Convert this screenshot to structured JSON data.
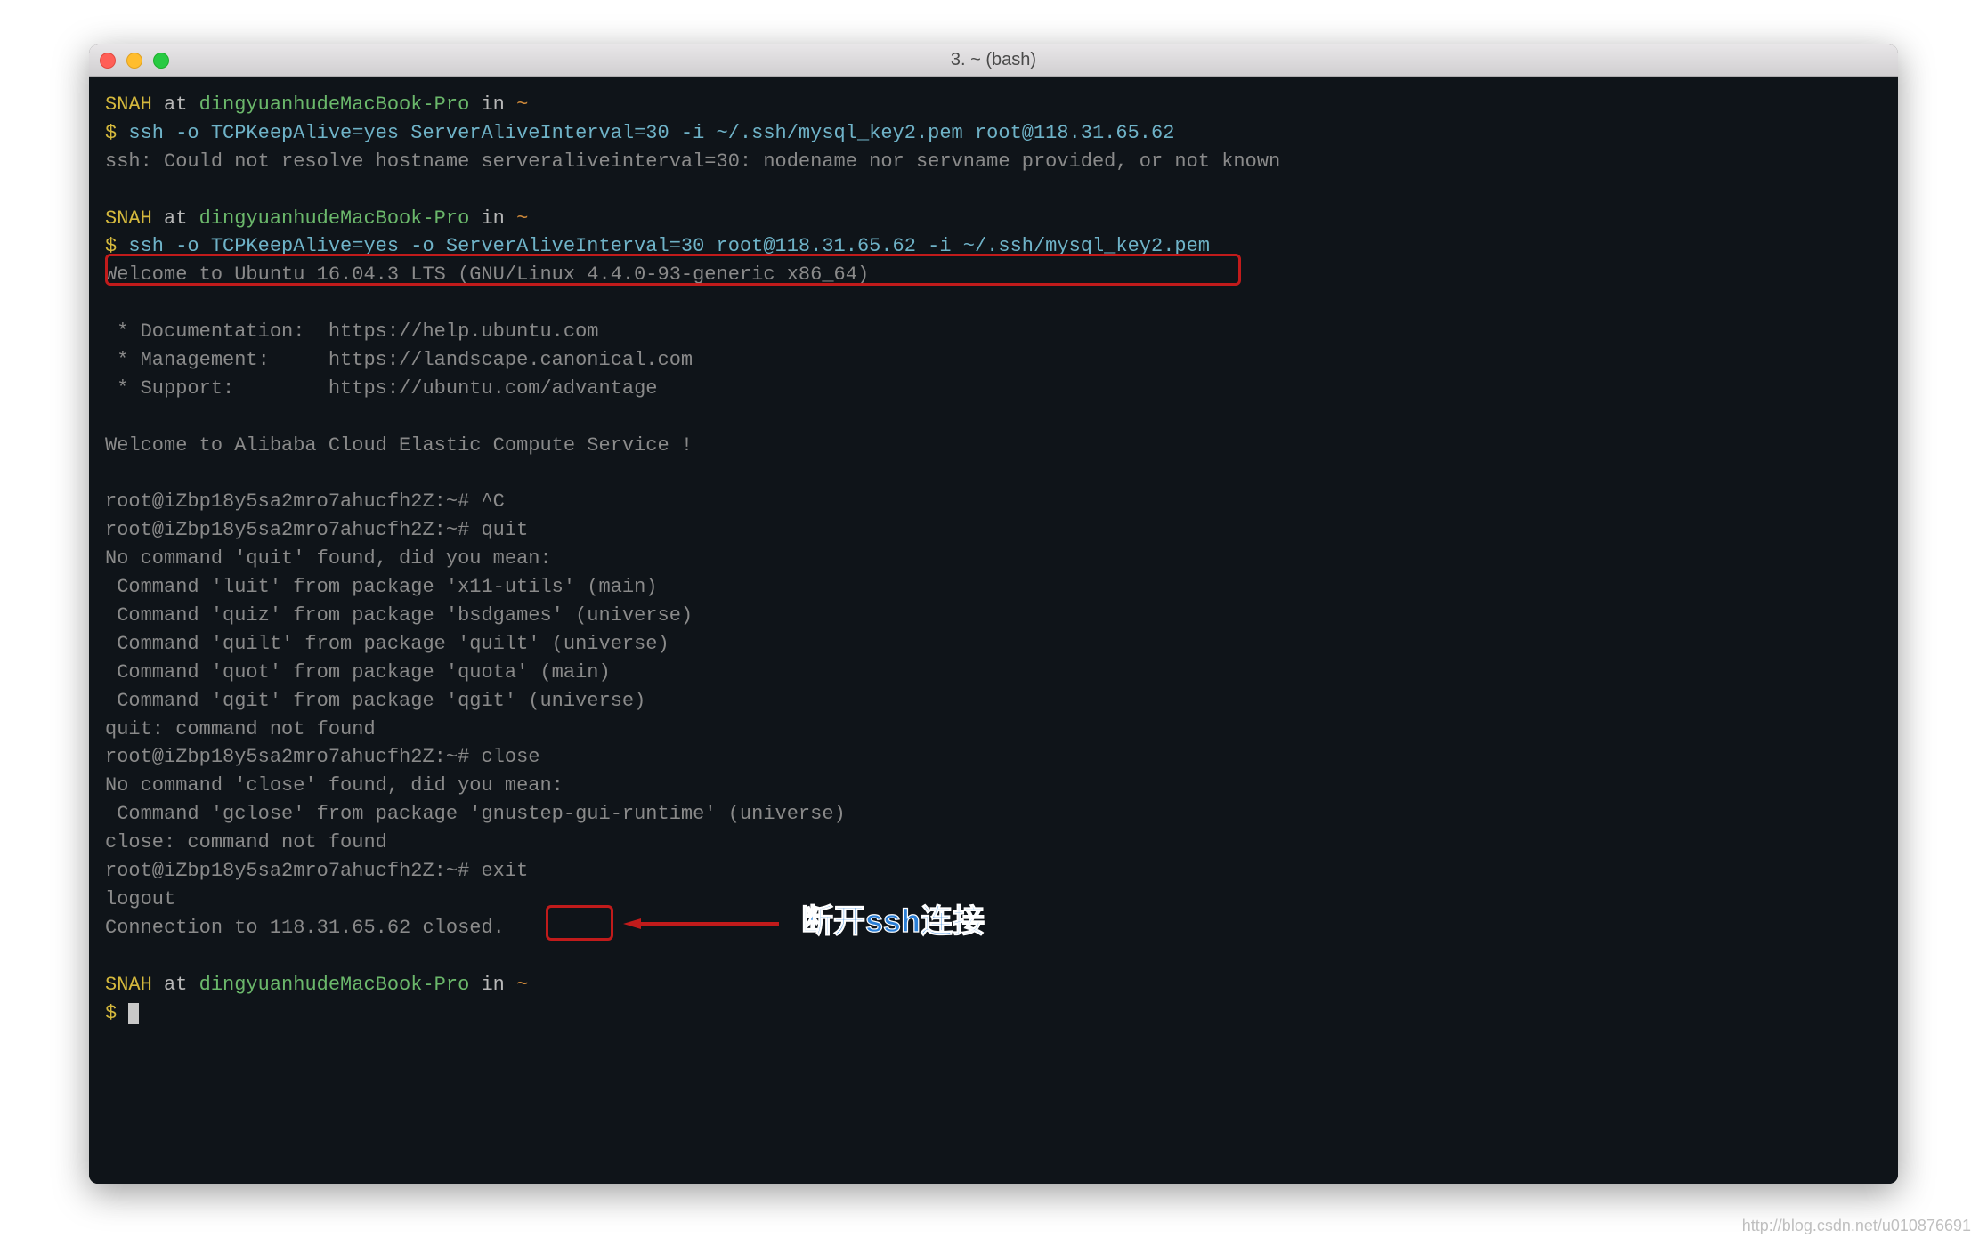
{
  "window": {
    "title": "3. ~ (bash)"
  },
  "prompt1": {
    "user": "SNAH",
    "at": " at ",
    "host": "dingyuanhudeMacBook-Pro",
    "in": " in ",
    "path": "~"
  },
  "line1": {
    "dollar": "$ ",
    "cmd": "ssh -o TCPKeepAlive=yes ServerAliveInterval=30 -i ~/.ssh/mysql_key2.pem root@118.31.65.62"
  },
  "line2": "ssh: Could not resolve hostname serveraliveinterval=30: nodename nor servname provided, or not known",
  "line3": {
    "dollar": "$ ",
    "cmd": "ssh -o TCPKeepAlive=yes -o ServerAliveInterval=30 root@118.31.65.62 -i ~/.ssh/mysql_key2.pem"
  },
  "line4": "Welcome to Ubuntu 16.04.3 LTS (GNU/Linux 4.4.0-93-generic x86_64)",
  "line5": " * Documentation:  https://help.ubuntu.com",
  "line6": " * Management:     https://landscape.canonical.com",
  "line7": " * Support:        https://ubuntu.com/advantage",
  "line8": "Welcome to Alibaba Cloud Elastic Compute Service !",
  "line9": "root@iZbp18y5sa2mro7ahucfh2Z:~# ^C",
  "line10": "root@iZbp18y5sa2mro7ahucfh2Z:~# quit",
  "line11": "No command 'quit' found, did you mean:",
  "line12": " Command 'luit' from package 'x11-utils' (main)",
  "line13": " Command 'quiz' from package 'bsdgames' (universe)",
  "line14": " Command 'quilt' from package 'quilt' (universe)",
  "line15": " Command 'quot' from package 'quota' (main)",
  "line16": " Command 'qgit' from package 'qgit' (universe)",
  "line17": "quit: command not found",
  "line18": "root@iZbp18y5sa2mro7ahucfh2Z:~# close",
  "line19": "No command 'close' found, did you mean:",
  "line20": " Command 'gclose' from package 'gnustep-gui-runtime' (universe)",
  "line21": "close: command not found",
  "line22": "root@iZbp18y5sa2mro7ahucfh2Z:~# exit",
  "line23": "logout",
  "line24": "Connection to 118.31.65.62 closed.",
  "finalPrompt": {
    "dollar": "$ "
  },
  "annotation": "断开ssh连接",
  "watermark": "http://blog.csdn.net/u010876691"
}
